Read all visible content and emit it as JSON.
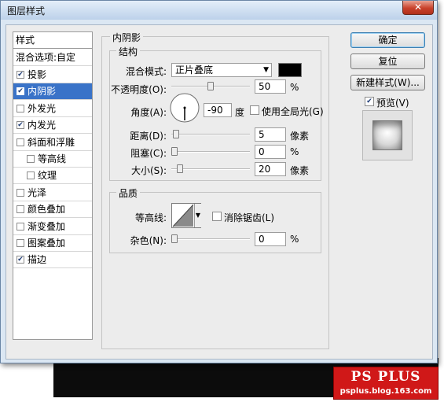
{
  "window": {
    "title": "图层样式",
    "close_glyph": "✕"
  },
  "styles_list": {
    "header": "样式",
    "blending": "混合选项:自定",
    "items": [
      {
        "label": "投影",
        "checked": true,
        "indent": false,
        "selected": false
      },
      {
        "label": "内阴影",
        "checked": true,
        "indent": false,
        "selected": true
      },
      {
        "label": "外发光",
        "checked": false,
        "indent": false,
        "selected": false
      },
      {
        "label": "内发光",
        "checked": true,
        "indent": false,
        "selected": false
      },
      {
        "label": "斜面和浮雕",
        "checked": false,
        "indent": false,
        "selected": false
      },
      {
        "label": "等高线",
        "checked": false,
        "indent": true,
        "selected": false
      },
      {
        "label": "纹理",
        "checked": false,
        "indent": true,
        "selected": false
      },
      {
        "label": "光泽",
        "checked": false,
        "indent": false,
        "selected": false
      },
      {
        "label": "颜色叠加",
        "checked": false,
        "indent": false,
        "selected": false
      },
      {
        "label": "渐变叠加",
        "checked": false,
        "indent": false,
        "selected": false
      },
      {
        "label": "图案叠加",
        "checked": false,
        "indent": false,
        "selected": false
      },
      {
        "label": "描边",
        "checked": true,
        "indent": false,
        "selected": false
      }
    ]
  },
  "inner_shadow": {
    "title": "内阴影",
    "structure": {
      "title": "结构",
      "blend_mode_label": "混合模式:",
      "blend_mode_value": "正片叠底",
      "swatch_color": "#000000",
      "opacity_label": "不透明度(O):",
      "opacity_value": "50",
      "opacity_unit": "%",
      "opacity_fraction": 0.5,
      "angle_label": "角度(A):",
      "angle_value": "-90",
      "angle_unit": "度",
      "angle_degrees": -90,
      "global_light_label": "使用全局光(G)",
      "global_light_checked": false,
      "distance_label": "距离(D):",
      "distance_value": "5",
      "distance_unit": "像素",
      "distance_fraction": 0.02,
      "choke_label": "阻塞(C):",
      "choke_value": "0",
      "choke_unit": "%",
      "choke_fraction": 0.0,
      "size_label": "大小(S):",
      "size_value": "20",
      "size_unit": "像素",
      "size_fraction": 0.08
    },
    "quality": {
      "title": "品质",
      "contour_label": "等高线:",
      "antialias_label": "消除锯齿(L)",
      "antialias_checked": false,
      "noise_label": "杂色(N):",
      "noise_value": "0",
      "noise_unit": "%",
      "noise_fraction": 0.0
    }
  },
  "buttons": {
    "ok": "确定",
    "reset": "复位",
    "new_style": "新建样式(W)...",
    "preview_label": "预览(V)",
    "preview_checked": true
  },
  "watermark": {
    "title": "PS PLUS",
    "url": "psplus.blog.163.com"
  }
}
